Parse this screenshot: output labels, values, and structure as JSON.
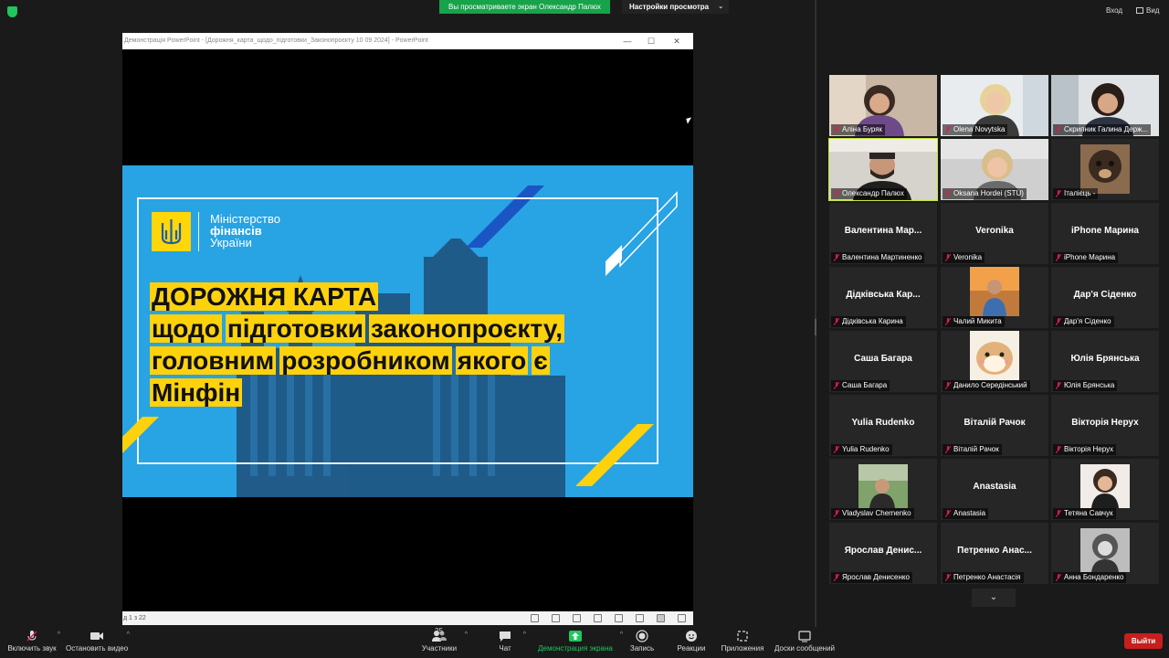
{
  "topbar": {
    "viewing_banner": "Вы просматриваете экран Олександр Палюх",
    "view_settings": "Настройки просмотра",
    "enter": "Вход",
    "view": "Вид"
  },
  "window": {
    "title": "Демонстрація PowerPoint - [Дорожня_карта_щодо_підготовки_Законопроєкту 10 09 2024] - PowerPoint",
    "minimize": "—",
    "maximize": "☐",
    "close": "✕",
    "status": "д 1 з 22"
  },
  "slide": {
    "logo_line1": "Міністерство",
    "logo_line2": "фінансів",
    "logo_line3": "України",
    "headline_line1": "ДОРОЖНЯ КАРТА",
    "headline_line2a": "щодо",
    "headline_line2b": "підготовки",
    "headline_line2c": "законопроєкту,",
    "headline_line3a": "головним",
    "headline_line3b": "розробником",
    "headline_line3c": "якого",
    "headline_line3d": "є",
    "headline_line4": "Мінфін"
  },
  "participants": [
    {
      "name": "Аліна Буряк",
      "center": "",
      "photo": "woman-glasses"
    },
    {
      "name": "Olena Novytska",
      "center": "",
      "photo": "woman-blonde"
    },
    {
      "name": "Скрипник Галина Держ...",
      "center": "",
      "photo": "woman-dark"
    },
    {
      "name": "Олександр Палюх",
      "center": "",
      "photo": "man-beard"
    },
    {
      "name": "Oksana Hordei (STU)",
      "center": "",
      "photo": "woman-blonde2"
    },
    {
      "name": "Італієць -",
      "center": "",
      "photo": "dog"
    },
    {
      "name": "Валентина Мартиненко",
      "center": "Валентина Мар...",
      "photo": ""
    },
    {
      "name": "Veronika",
      "center": "Veronika",
      "photo": ""
    },
    {
      "name": "iPhone Марина",
      "center": "iPhone Марина",
      "photo": ""
    },
    {
      "name": "Дідківська Карина",
      "center": "Дідківська Кар...",
      "photo": ""
    },
    {
      "name": "Чалий Микита",
      "center": "",
      "photo": "man-sunset"
    },
    {
      "name": "Дар'я Сіденко",
      "center": "Дар'я Сіденко",
      "photo": ""
    },
    {
      "name": "Саша Багара",
      "center": "Саша Багара",
      "photo": ""
    },
    {
      "name": "Данило Середінський",
      "center": "",
      "photo": "hamster"
    },
    {
      "name": "Юлія Брянська",
      "center": "Юлія Брянська",
      "photo": ""
    },
    {
      "name": "Yulia Rudenko",
      "center": "Yulia Rudenko",
      "photo": ""
    },
    {
      "name": "Віталій Рачок",
      "center": "Віталій Рачок",
      "photo": ""
    },
    {
      "name": "Вікторія Нерух",
      "center": "Вікторія Нерух",
      "photo": ""
    },
    {
      "name": "Vladyslav Chernenko",
      "center": "",
      "photo": "man-outdoor"
    },
    {
      "name": "Anastasia",
      "center": "Anastasia",
      "photo": ""
    },
    {
      "name": "Тетяна Савчук",
      "center": "",
      "photo": "woman-portrait"
    },
    {
      "name": "Ярослав Денисенко",
      "center": "Ярослав Денис...",
      "photo": ""
    },
    {
      "name": "Петренко Анастасія",
      "center": "Петренко Анас...",
      "photo": ""
    },
    {
      "name": "Анна Бондаренко",
      "center": "",
      "photo": "woman-bw"
    }
  ],
  "toolbar": {
    "unmute": "Включить звук",
    "stop_video": "Остановить видео",
    "participants": "Участники",
    "participants_count": "25",
    "chat": "Чат",
    "share": "Демонстрация экрана",
    "record": "Запись",
    "reactions": "Реакции",
    "apps": "Приложения",
    "whiteboards": "Доски сообщений",
    "leave": "Выйти"
  },
  "colors": {
    "slide_blue": "#28a3e4",
    "highlight_yellow": "#fdd20d",
    "active_speaker": "#c6e63e",
    "share_green": "#22c55e",
    "leave_red": "#c81e1e"
  }
}
